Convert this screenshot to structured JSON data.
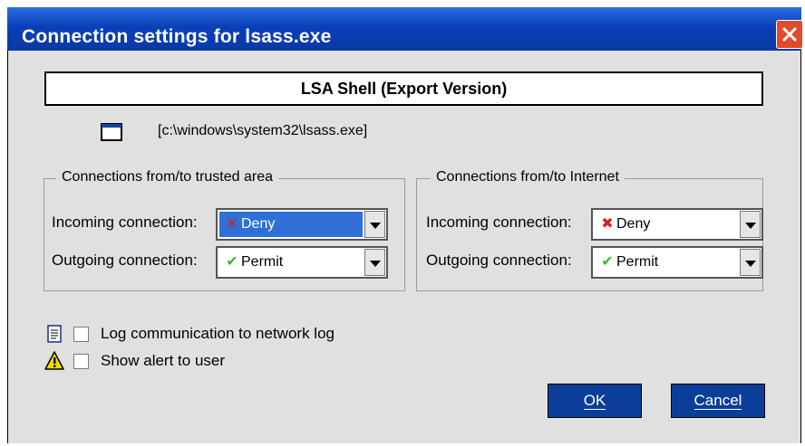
{
  "window": {
    "title": "Connection settings for lsass.exe",
    "close_icon": "close-icon"
  },
  "app": {
    "name": "LSA Shell (Export Version)",
    "path": "[c:\\windows\\system32\\lsass.exe]",
    "icon": "application-window-icon"
  },
  "trusted": {
    "title": "Connections from/to trusted area",
    "incoming_label": "Incoming connection:",
    "incoming_value": "Deny",
    "outgoing_label": "Outgoing connection:",
    "outgoing_value": "Permit"
  },
  "internet": {
    "title": "Connections from/to Internet",
    "incoming_label": "Incoming connection:",
    "incoming_value": "Deny",
    "outgoing_label": "Outgoing connection:",
    "outgoing_value": "Permit"
  },
  "options": {
    "log_label": "Log communication to network log",
    "log_checked": false,
    "alert_label": "Show alert to user",
    "alert_checked": false
  },
  "buttons": {
    "ok": "OK",
    "cancel": "Cancel"
  },
  "colors": {
    "titlebar": "#0b3aa6",
    "selection": "#2f6fd6",
    "button": "#0a3e98",
    "deny": "#d42020",
    "permit": "#3cb832"
  }
}
